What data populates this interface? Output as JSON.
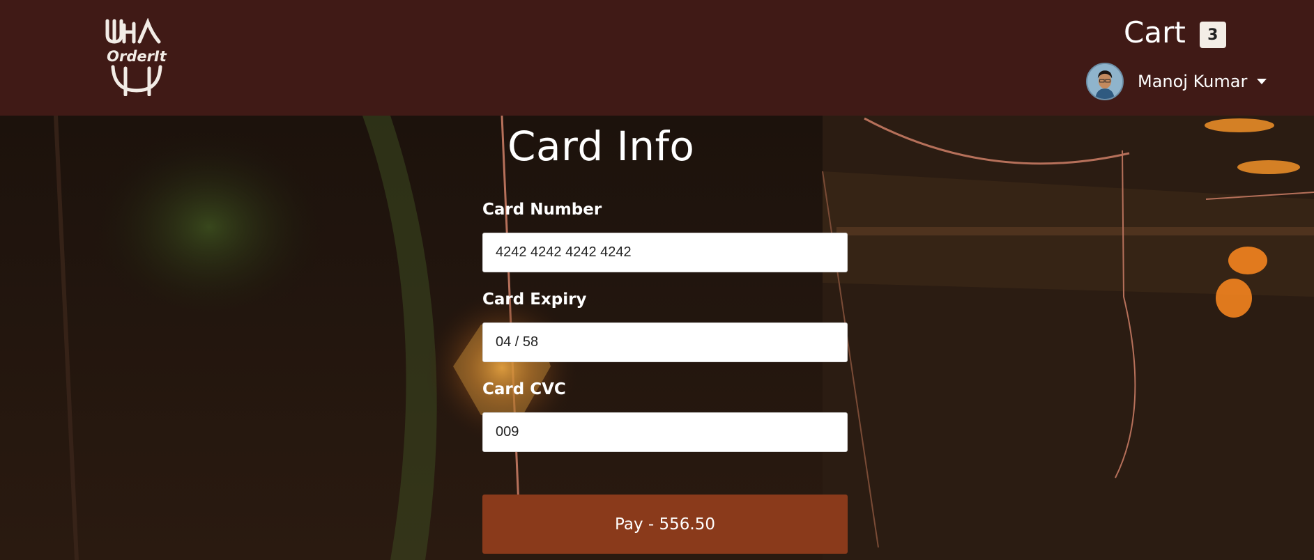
{
  "app": {
    "logo_text": "OrderIt"
  },
  "header": {
    "cart_label": "Cart",
    "cart_count": "3",
    "user_name": "Manoj Kumar"
  },
  "form": {
    "title": "Card Info",
    "card_number": {
      "label": "Card Number",
      "value": "4242 4242 4242 4242"
    },
    "card_expiry": {
      "label": "Card Expiry",
      "value": "04 / 58"
    },
    "card_cvc": {
      "label": "Card CVC",
      "value": "009"
    },
    "pay_button_label": "Pay - 556.50"
  },
  "colors": {
    "header_bg": "#401a16",
    "pay_button": "#8a3a1b",
    "page_bg": "#1a0f0a"
  }
}
